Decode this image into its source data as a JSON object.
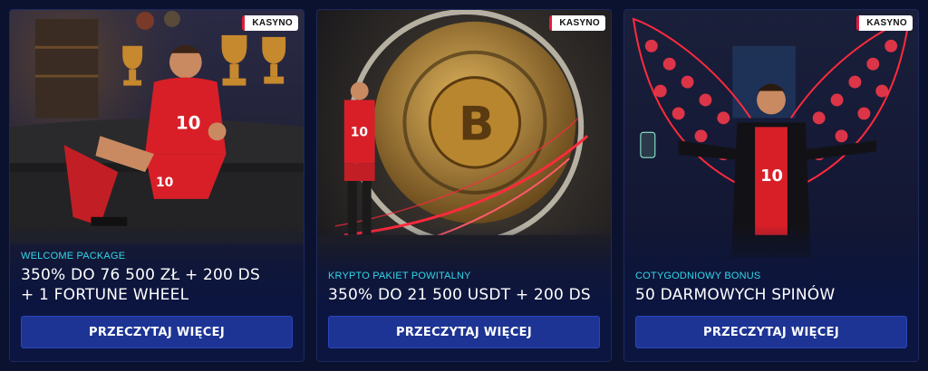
{
  "cards": [
    {
      "badge": "KASYNO",
      "subtitle": "WELCOME PACKAGE",
      "title_line1": "350% DO 76 500 ZŁ + 200 DS",
      "title_line2": "+ 1 FORTUNE WHEEL",
      "button": "PRZECZYTAJ WIĘCEJ"
    },
    {
      "badge": "KASYNO",
      "subtitle": "KRYPTO PAKIET POWITALNY",
      "title_line1": "350% DO 21 500 USDT + 200 DS",
      "button": "PRZECZYTAJ WIĘCEJ"
    },
    {
      "badge": "KASYNO",
      "subtitle": "COTYGODNIOWY BONUS",
      "title_line1": "50 DARMOWYCH SPINÓW",
      "button": "PRZECZYTAJ WIĘCEJ"
    }
  ],
  "images": {
    "card1": "footballer-on-couch-with-trophies",
    "card2": "footballer-at-bitcoin-vault",
    "card3": "footballer-with-neon-chip-wings"
  },
  "player_number": "10",
  "colors": {
    "background": "#0b1230",
    "card_bg": "#0c1540",
    "subtitle": "#33d6e6",
    "button": "#1d3494",
    "badge_accent": "#e01c3c",
    "neon_red": "#ff2a3c"
  }
}
